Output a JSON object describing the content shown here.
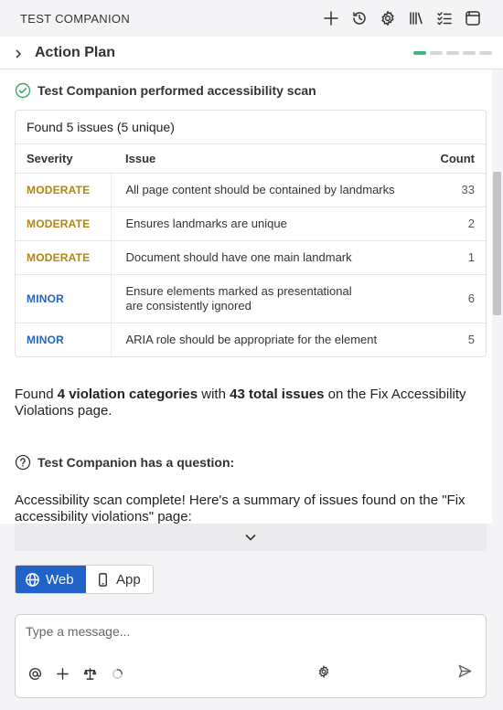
{
  "header": {
    "title": "TEST COMPANION",
    "icons": [
      "plus-icon",
      "history-icon",
      "gear-icon",
      "library-icon",
      "checklist-icon",
      "panel-icon"
    ]
  },
  "action_plan": {
    "title": "Action Plan",
    "progress_steps_total": 5,
    "progress_steps_done": 1,
    "progress_color": "#44b380"
  },
  "scan": {
    "heading": "Test Companion performed accessibility scan",
    "found_text": "Found 5 issues (5 unique)",
    "columns": {
      "severity": "Severity",
      "issue": "Issue",
      "count": "Count"
    },
    "rows": [
      {
        "severity": "MODERATE",
        "issue": "All page content should be contained by landmarks",
        "count": "33"
      },
      {
        "severity": "MODERATE",
        "issue": "Ensures landmarks are unique",
        "count": "2"
      },
      {
        "severity": "MODERATE",
        "issue": "Document should have one main landmark",
        "count": "1"
      },
      {
        "severity": "MINOR",
        "issue": "Ensure elements marked as presentational are consistently ignored",
        "count": "6"
      },
      {
        "severity": "MINOR",
        "issue": "ARIA role should be appropriate for the element",
        "count": "5"
      }
    ],
    "colors": {
      "moderate": "#b38411",
      "minor": "#2265c4"
    }
  },
  "summary": {
    "prefix": "Found ",
    "bold1": "4 violation categories",
    "middle": " with ",
    "bold2": "43 total issues",
    "suffix": " on the Fix Accessibility Violations page."
  },
  "question": {
    "heading": "Test Companion has a question:",
    "answer": "Accessibility scan complete! Here's a summary of issues found on the \"Fix accessibility violations\" page:"
  },
  "mode_toggle": {
    "web_label": "Web",
    "app_label": "App",
    "selected": "Web",
    "accent": "#2062c8"
  },
  "composer": {
    "placeholder": "Type a message...",
    "value": ""
  }
}
